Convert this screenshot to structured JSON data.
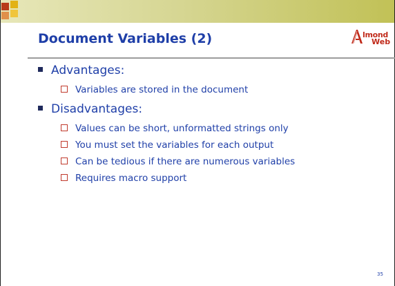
{
  "slide": {
    "title": "Document Variables (2)",
    "logo": {
      "line1": "lmond",
      "line2": "Web"
    },
    "sections": [
      {
        "heading": "Advantages:",
        "items": [
          "Variables are stored in the document"
        ]
      },
      {
        "heading": "Disadvantages:",
        "items": [
          "Values can be short, unformatted strings only",
          "You must set the variables for each output",
          "Can be tedious if there are numerous variables",
          "Requires macro support"
        ]
      }
    ],
    "page_number": "35"
  },
  "colors": {
    "title": "#1f3fa8",
    "body_text": "#1f3fa8",
    "logo": "#c02a1a",
    "sub_bullet_box": "#c0392b",
    "main_bullet": "#1f2a5c",
    "top_bar_start": "#e7e7b9",
    "top_bar_end": "#c1c156"
  },
  "icons": {
    "logo": "almond-web-logo",
    "main_bullet": "square-bullet",
    "sub_bullet": "hollow-square-bullet"
  }
}
